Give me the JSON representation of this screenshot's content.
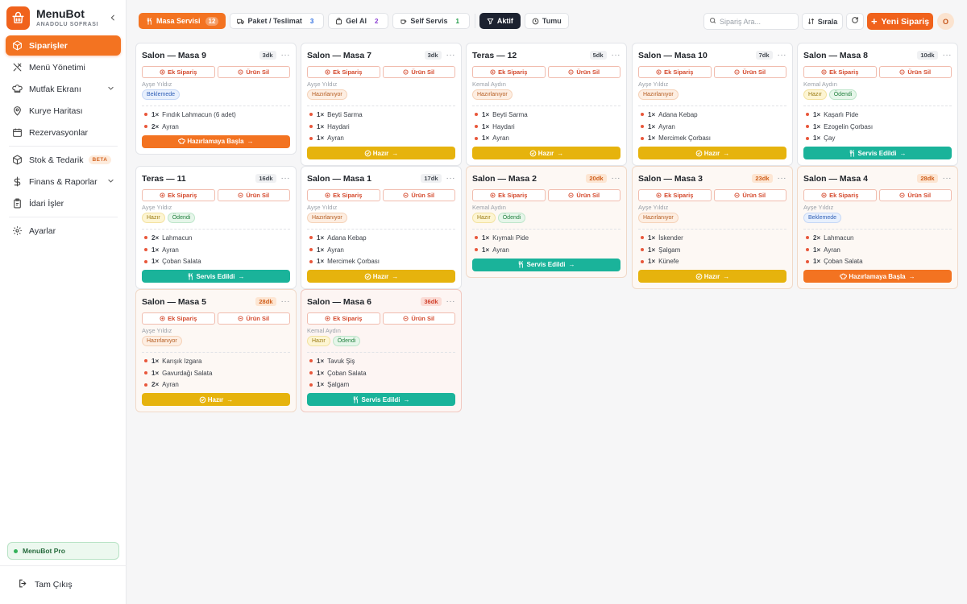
{
  "brand": {
    "name": "MenuBot",
    "subtitle": "ANADOLU SOFRASI"
  },
  "colors": {
    "accent": "#f0621c",
    "ready": "#e6b30d",
    "served": "#1ab39a",
    "dark": "#1c2230"
  },
  "sidebar": {
    "items": [
      {
        "label": "Siparişler",
        "icon": "receipt-icon",
        "active": true
      },
      {
        "label": "Menü Yönetimi",
        "icon": "utensils-icon"
      },
      {
        "label": "Mutfak Ekranı",
        "icon": "chef-hat-icon",
        "expandable": true
      },
      {
        "label": "Kurye Haritası",
        "icon": "map-pin-icon"
      },
      {
        "label": "Rezervasyonlar",
        "icon": "calendar-icon"
      },
      {
        "label": "Stok & Tedarik",
        "icon": "box-icon",
        "tag": "BETA"
      },
      {
        "label": "Finans & Raporlar",
        "icon": "dollar-icon",
        "expandable": true
      },
      {
        "label": "İdari İşler",
        "icon": "clipboard-icon"
      },
      {
        "label": "Ayarlar",
        "icon": "gear-icon"
      }
    ],
    "pro_label": "MenuBot Pro",
    "logout_label": "Tam Çıkış"
  },
  "toolbar": {
    "tabs": [
      {
        "label": "Masa Servisi",
        "count": "12"
      },
      {
        "label": "Paket / Teslimat",
        "count": "3"
      },
      {
        "label": "Gel Al",
        "count": "2"
      },
      {
        "label": "Self Servis",
        "count": "1"
      }
    ],
    "filters": {
      "active": "Aktif",
      "all": "Tumu"
    },
    "search_placeholder": "Sipariş Ara...",
    "sort_label": "Sırala",
    "new_order_label": "Yeni Sipariş",
    "avatar_initial": "O"
  },
  "labels": {
    "extra": "Ek Sipariş",
    "remove": "Ürün Sil"
  },
  "orders": [
    {
      "title": "Salon — Masa 9",
      "age": "3dk",
      "waiter": "Ayşe Yıldız",
      "badges": [
        "Beklemede"
      ],
      "items": [
        [
          "1×",
          "Fındık Lahmacun (6 adet)"
        ],
        [
          "2×",
          "Ayran"
        ]
      ],
      "action": "Hazırlamaya Başla"
    },
    {
      "title": "Salon — Masa 7",
      "age": "3dk",
      "waiter": "Ayşe Yıldız",
      "badges": [
        "Hazırlanıyor"
      ],
      "items": [
        [
          "1×",
          "Beyti Sarma"
        ],
        [
          "1×",
          "Haydari"
        ],
        [
          "1×",
          "Ayran"
        ]
      ],
      "action": "Hazır"
    },
    {
      "title": "Teras — 12",
      "age": "5dk",
      "waiter": "Kemal Aydın",
      "badges": [
        "Hazırlanıyor"
      ],
      "items": [
        [
          "1×",
          "Beyti Sarma"
        ],
        [
          "1×",
          "Haydari"
        ],
        [
          "1×",
          "Ayran"
        ]
      ],
      "action": "Hazır"
    },
    {
      "title": "Salon — Masa 10",
      "age": "7dk",
      "waiter": "Ayşe Yıldız",
      "badges": [
        "Hazırlanıyor"
      ],
      "items": [
        [
          "1×",
          "Adana Kebap"
        ],
        [
          "1×",
          "Ayran"
        ],
        [
          "1×",
          "Mercimek Çorbası"
        ]
      ],
      "action": "Hazır"
    },
    {
      "title": "Salon — Masa 8",
      "age": "10dk",
      "waiter": "Kemal Aydın",
      "badges": [
        "Hazır",
        "Ödendi"
      ],
      "items": [
        [
          "1×",
          "Kaşarlı Pide"
        ],
        [
          "1×",
          "Ezogelin Çorbası"
        ],
        [
          "1×",
          "Çay"
        ]
      ],
      "action": "Servis Edildi"
    },
    {
      "title": "Teras — 11",
      "age": "16dk",
      "waiter": "Ayşe Yıldız",
      "badges": [
        "Hazır",
        "Ödendi"
      ],
      "items": [
        [
          "2×",
          "Lahmacun"
        ],
        [
          "1×",
          "Ayran"
        ],
        [
          "1×",
          "Çoban Salata"
        ]
      ],
      "action": "Servis Edildi"
    },
    {
      "title": "Salon — Masa 1",
      "age": "17dk",
      "waiter": "Ayşe Yıldız",
      "badges": [
        "Hazırlanıyor"
      ],
      "items": [
        [
          "1×",
          "Adana Kebap"
        ],
        [
          "1×",
          "Ayran"
        ],
        [
          "1×",
          "Mercimek Çorbası"
        ]
      ],
      "action": "Hazır"
    },
    {
      "title": "Salon — Masa 2",
      "age": "20dk",
      "waiter": "Kemal Aydın",
      "badges": [
        "Hazır",
        "Ödendi"
      ],
      "items": [
        [
          "1×",
          "Kıymalı Pide"
        ],
        [
          "1×",
          "Ayran"
        ]
      ],
      "action": "Servis Edildi"
    },
    {
      "title": "Salon — Masa 3",
      "age": "23dk",
      "waiter": "Ayşe Yıldız",
      "badges": [
        "Hazırlanıyor"
      ],
      "items": [
        [
          "1×",
          "İskender"
        ],
        [
          "1×",
          "Şalgam"
        ],
        [
          "1×",
          "Künefe"
        ]
      ],
      "action": "Hazır"
    },
    {
      "title": "Salon — Masa 4",
      "age": "28dk",
      "waiter": "Ayşe Yıldız",
      "badges": [
        "Beklemede"
      ],
      "items": [
        [
          "2×",
          "Lahmacun"
        ],
        [
          "1×",
          "Ayran"
        ],
        [
          "1×",
          "Çoban Salata"
        ]
      ],
      "action": "Hazırlamaya Başla"
    },
    {
      "title": "Salon — Masa 5",
      "age": "28dk",
      "waiter": "Ayşe Yıldız",
      "badges": [
        "Hazırlanıyor"
      ],
      "items": [
        [
          "1×",
          "Karışık Izgara"
        ],
        [
          "1×",
          "Gavurdağı Salata"
        ],
        [
          "2×",
          "Ayran"
        ]
      ],
      "action": "Hazır"
    },
    {
      "title": "Salon — Masa 6",
      "age": "36dk",
      "waiter": "Kemal Aydın",
      "badges": [
        "Hazır",
        "Ödendi"
      ],
      "items": [
        [
          "1×",
          "Tavuk Şiş"
        ],
        [
          "1×",
          "Çoban Salata"
        ],
        [
          "1×",
          "Şalgam"
        ]
      ],
      "action": "Servis Edildi"
    }
  ]
}
